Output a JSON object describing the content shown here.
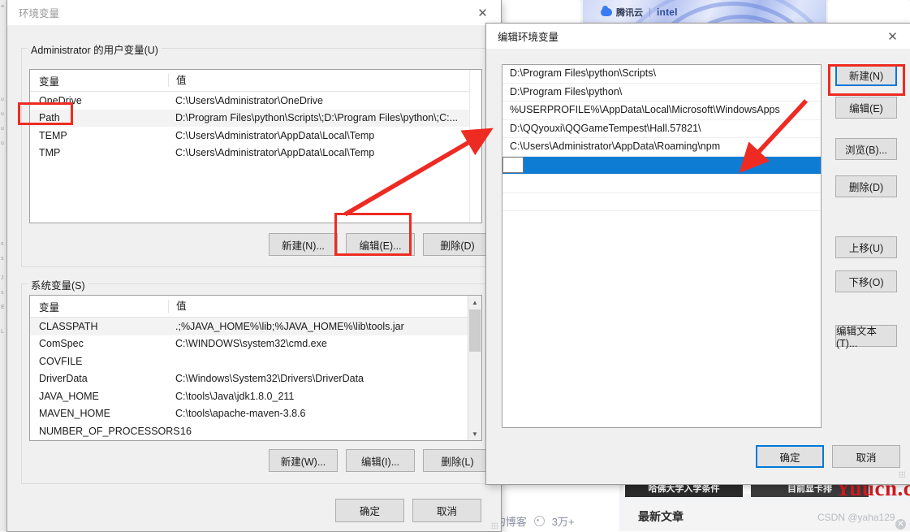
{
  "background": {
    "banner": {
      "cloud_label": "腾讯云",
      "intel_label": "intel"
    },
    "thumbnails": [
      {
        "caption": "哈佛大学入学条件"
      },
      {
        "caption": "目前显卡排"
      }
    ],
    "blog_label": "by的博客",
    "views": "3万+",
    "latest_articles": "最新文章",
    "csdn_credit": "CSDN @yaha129",
    "watermark": "Yuucn.com"
  },
  "env_dialog": {
    "title": "环境变量",
    "close_icon": "close-icon",
    "user_section": {
      "label": "Administrator 的用户变量(U)",
      "columns": [
        "变量",
        "值"
      ],
      "rows": [
        {
          "name": "OneDrive",
          "value": "C:\\Users\\Administrator\\OneDrive"
        },
        {
          "name": "Path",
          "value": "D:\\Program Files\\python\\Scripts\\;D:\\Program Files\\python\\;C:..."
        },
        {
          "name": "TEMP",
          "value": "C:\\Users\\Administrator\\AppData\\Local\\Temp"
        },
        {
          "name": "TMP",
          "value": "C:\\Users\\Administrator\\AppData\\Local\\Temp"
        }
      ],
      "buttons": {
        "new": "新建(N)...",
        "edit": "编辑(E)...",
        "delete": "删除(D)"
      }
    },
    "system_section": {
      "label": "系统变量(S)",
      "columns": [
        "变量",
        "值"
      ],
      "rows": [
        {
          "name": "CLASSPATH",
          "value": ".;%JAVA_HOME%\\lib;%JAVA_HOME%\\lib\\tools.jar"
        },
        {
          "name": "ComSpec",
          "value": "C:\\WINDOWS\\system32\\cmd.exe"
        },
        {
          "name": "COVFILE",
          "value": ""
        },
        {
          "name": "DriverData",
          "value": "C:\\Windows\\System32\\Drivers\\DriverData"
        },
        {
          "name": "JAVA_HOME",
          "value": "C:\\tools\\Java\\jdk1.8.0_211"
        },
        {
          "name": "MAVEN_HOME",
          "value": "C:\\tools\\apache-maven-3.8.6"
        },
        {
          "name": "NUMBER_OF_PROCESSORS",
          "value": "16"
        }
      ],
      "buttons": {
        "new": "新建(W)...",
        "edit": "编辑(I)...",
        "delete": "删除(L)"
      }
    },
    "footer": {
      "ok": "确定",
      "cancel": "取消"
    }
  },
  "edit_dialog": {
    "title": "编辑环境变量",
    "close_icon": "close-icon",
    "paths": [
      "D:\\Program Files\\python\\Scripts\\",
      "D:\\Program Files\\python\\",
      "%USERPROFILE%\\AppData\\Local\\Microsoft\\WindowsApps",
      "D:\\QQyouxi\\QQGameTempest\\Hall.57821\\",
      "C:\\Users\\Administrator\\AppData\\Roaming\\npm"
    ],
    "new_row_value": "",
    "side_buttons": {
      "new": "新建(N)",
      "edit": "编辑(E)",
      "browse": "浏览(B)...",
      "delete": "删除(D)",
      "move_up": "上移(U)",
      "move_down": "下移(O)",
      "edit_text": "编辑文本(T)..."
    },
    "footer": {
      "ok": "确定",
      "cancel": "取消"
    }
  },
  "annotations": {
    "accent_red": "#ee2b22",
    "selection_blue": "#0f7cd4",
    "focus_blue": "#0078d7"
  }
}
